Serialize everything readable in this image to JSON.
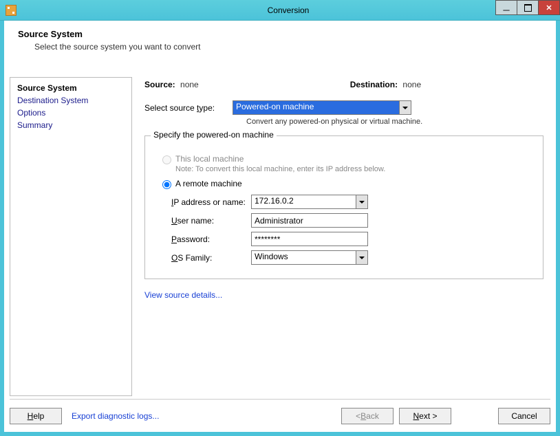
{
  "window": {
    "title": "Conversion"
  },
  "header": {
    "title": "Source System",
    "subtitle": "Select the source system you want to convert"
  },
  "sidebar": {
    "items": [
      {
        "label": "Source System",
        "active": true
      },
      {
        "label": "Destination System",
        "active": false
      },
      {
        "label": "Options",
        "active": false
      },
      {
        "label": "Summary",
        "active": false
      }
    ]
  },
  "summary": {
    "source_label": "Source:",
    "source_value": "none",
    "dest_label": "Destination:",
    "dest_value": "none"
  },
  "sourcetype": {
    "label_pre": "Select source ",
    "label_ul": "t",
    "label_post": "ype:",
    "value": "Powered-on machine",
    "help": "Convert any powered-on physical or virtual machine."
  },
  "group": {
    "legend": "Specify the powered-on machine",
    "local": {
      "label": "This local machine",
      "hint": "Note: To convert this local machine, enter its IP address below."
    },
    "remote": {
      "label_pre": "A ",
      "label_ul": "r",
      "label_post": "emote machine"
    },
    "ip": {
      "label_ul": "I",
      "label": "P address or name:",
      "value": "172.16.0.2"
    },
    "user": {
      "label_ul": "U",
      "label": "ser name:",
      "value": "Administrator"
    },
    "pass": {
      "label_ul": "P",
      "label": "assword:",
      "value": "********"
    },
    "os": {
      "label_ul": "O",
      "label": "S Family:",
      "value": "Windows"
    }
  },
  "links": {
    "view_details": "View source details...",
    "export_logs": "Export diagnostic logs..."
  },
  "buttons": {
    "help_ul": "H",
    "help": "elp",
    "back_pre": "< ",
    "back_ul": "B",
    "back": "ack",
    "next_ul": "N",
    "next": "ext >",
    "cancel": "Cancel"
  }
}
